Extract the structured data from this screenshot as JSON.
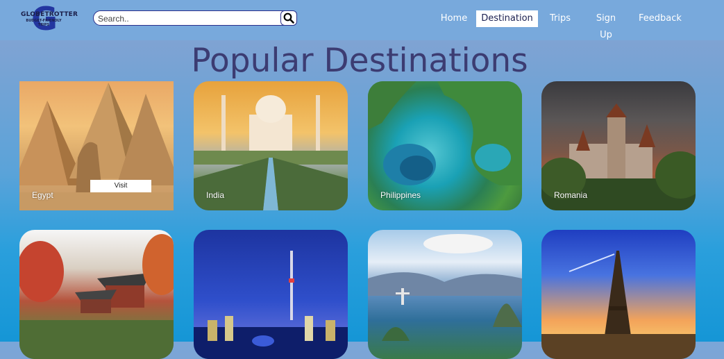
{
  "header": {
    "logo": {
      "title": "GLOBETROTTER",
      "tagline": "BUDGET-FRIENDLY TRIPS",
      "mark": "G"
    },
    "search": {
      "placeholder": "Search..",
      "icon": "search-icon"
    },
    "nav": [
      {
        "id": "home",
        "label": "Home",
        "active": false
      },
      {
        "id": "destination",
        "label": "Destination",
        "active": true
      },
      {
        "id": "trips",
        "label": "Trips",
        "active": false
      },
      {
        "id": "signup",
        "label": "Sign Up",
        "active": false
      },
      {
        "id": "feedback",
        "label": "Feedback",
        "active": false
      }
    ]
  },
  "main": {
    "title": "Popular Destinations",
    "visit_label": "Visit",
    "destinations": [
      {
        "name": "Egypt"
      },
      {
        "name": "India"
      },
      {
        "name": "Philippines"
      },
      {
        "name": "Romania"
      },
      {
        "name": ""
      },
      {
        "name": ""
      },
      {
        "name": ""
      },
      {
        "name": ""
      }
    ]
  },
  "colors": {
    "accent": "#2336a0",
    "title": "#3c3c72",
    "topbar": "#78a9dc"
  }
}
